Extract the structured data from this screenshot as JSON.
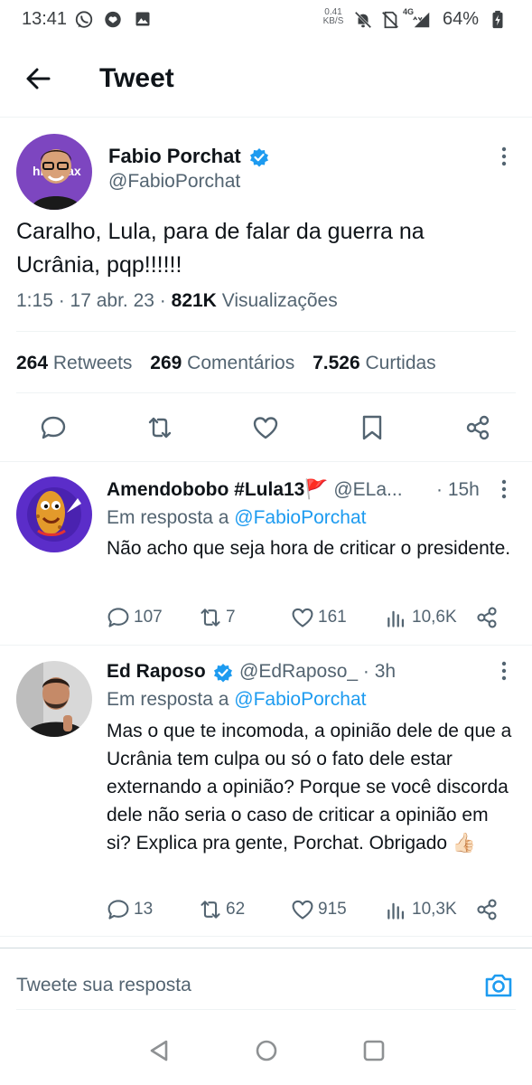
{
  "status_bar": {
    "time": "13:41",
    "net_speed_value": "0.41",
    "net_speed_unit": "KB/S",
    "network_type": "4G",
    "battery": "64%",
    "icons": [
      "whatsapp-icon",
      "chat-icon",
      "gallery-icon",
      "mute-icon",
      "no-sim-icon",
      "signal-icon",
      "battery-charging-icon"
    ]
  },
  "header": {
    "title": "Tweet"
  },
  "tweet": {
    "author_name": "Fabio Porchat",
    "author_handle": "@FabioPorchat",
    "text": "Caralho, Lula, para de falar da guerra na Ucrânia, pqp!!!!!!",
    "time": "1:15",
    "date": "17 abr. 23",
    "views_count": "821K",
    "views_label": "Visualizações",
    "stats": {
      "retweets_count": "264",
      "retweets_label": "Retweets",
      "comments_count": "269",
      "comments_label": "Comentários",
      "likes_count": "7.526",
      "likes_label": "Curtidas"
    },
    "actions": [
      "reply-icon",
      "retweet-icon",
      "like-icon",
      "bookmark-icon",
      "share-icon"
    ]
  },
  "replies": [
    {
      "name": "Amendobobo #Lula13",
      "flag": "🚩",
      "handle": "@ELa...",
      "time": "· 15h",
      "reply_prefix": "Em resposta a",
      "reply_to": "@FabioPorchat",
      "text": "Não acho que seja hora de criticar o presidente.",
      "replies": "107",
      "retweets": "7",
      "likes": "161",
      "views": "10,6K"
    },
    {
      "name": "Ed Raposo",
      "handle": "@EdRaposo_",
      "time": "· 3h",
      "reply_prefix": "Em resposta a",
      "reply_to": "@FabioPorchat",
      "text": "Mas o que te incomoda, a opinião dele de que a Ucrânia tem culpa ou só o fato dele estar externando a opinião? Porque se você discorda dele não seria o caso de criticar a opinião em si? Explica pra gente, Porchat. Obrigado 👍🏻",
      "replies": "13",
      "retweets": "62",
      "likes": "915",
      "views": "10,3K"
    }
  ],
  "compose": {
    "placeholder": "Tweete sua resposta"
  },
  "nav_bar": {
    "buttons": [
      "back-triangle-icon",
      "home-circle-icon",
      "recents-square-icon"
    ]
  },
  "colors": {
    "accent": "#1d9bf0",
    "secondary_text": "#536471",
    "text": "#0f1419"
  }
}
